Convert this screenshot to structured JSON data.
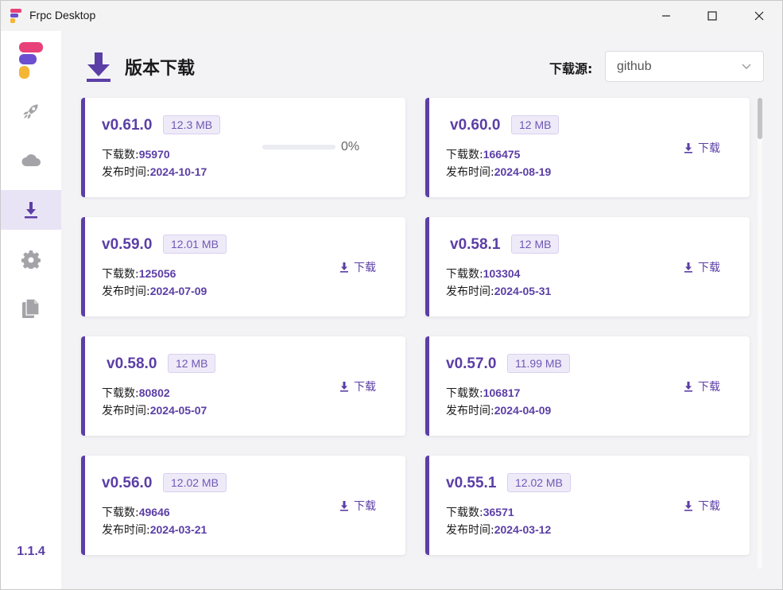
{
  "window": {
    "title": "Frpc Desktop"
  },
  "sidebar": {
    "items": [
      {
        "icon": "rocket-icon"
      },
      {
        "icon": "cloud-icon"
      },
      {
        "icon": "download-icon",
        "active": true
      },
      {
        "icon": "gear-icon"
      },
      {
        "icon": "documents-icon"
      }
    ],
    "version": "1.1.4"
  },
  "header": {
    "title": "版本下载",
    "source_label": "下载源:",
    "source_value": "github"
  },
  "labels": {
    "downloads": "下载数:",
    "published": "发布时间:",
    "download_action": "下载"
  },
  "releases": [
    {
      "version": "v0.61.0",
      "size": "12.3 MB",
      "downloads": "95970",
      "date": "2024-10-17",
      "progress": "0%"
    },
    {
      "version": "v0.60.0",
      "size": "12 MB",
      "downloads": "166475",
      "date": "2024-08-19"
    },
    {
      "version": "v0.59.0",
      "size": "12.01 MB",
      "downloads": "125056",
      "date": "2024-07-09"
    },
    {
      "version": "v0.58.1",
      "size": "12 MB",
      "downloads": "103304",
      "date": "2024-05-31"
    },
    {
      "version": "v0.58.0",
      "size": "12 MB",
      "downloads": "80802",
      "date": "2024-05-07"
    },
    {
      "version": "v0.57.0",
      "size": "11.99 MB",
      "downloads": "106817",
      "date": "2024-04-09"
    },
    {
      "version": "v0.56.0",
      "size": "12.02 MB",
      "downloads": "49646",
      "date": "2024-03-21"
    },
    {
      "version": "v0.55.1",
      "size": "12.02 MB",
      "downloads": "36571",
      "date": "2024-03-12"
    }
  ],
  "colors": {
    "accent": "#5b3ea6",
    "active_nav_bg": "#e9e4f5",
    "page_bg": "#f3f3f6"
  }
}
